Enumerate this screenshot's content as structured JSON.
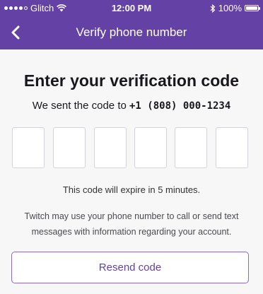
{
  "status_bar": {
    "carrier": "Glitch",
    "time": "12:00 PM",
    "battery": "100%",
    "signal_icon": "signal-dots-icon",
    "wifi_icon": "wifi-icon",
    "bluetooth_icon": "bluetooth-icon",
    "battery_icon": "battery-icon"
  },
  "nav": {
    "title": "Verify phone number",
    "back_icon": "chevron-left-icon"
  },
  "main": {
    "heading": "Enter your verification code",
    "subheading_prefix": "We sent the code to",
    "phone_number": "+1 (808) 000-1234",
    "code_boxes": [
      "",
      "",
      "",
      "",
      "",
      ""
    ],
    "expire_note": "This code will expire in 5 minutes.",
    "disclaimer": "Twitch may use your phone number to call or send text messages with information regarding your account.",
    "resend_label": "Resend code"
  },
  "colors": {
    "brand": "#6441a5",
    "button_border": "#8a6bc0",
    "background": "#f7f7f8"
  }
}
